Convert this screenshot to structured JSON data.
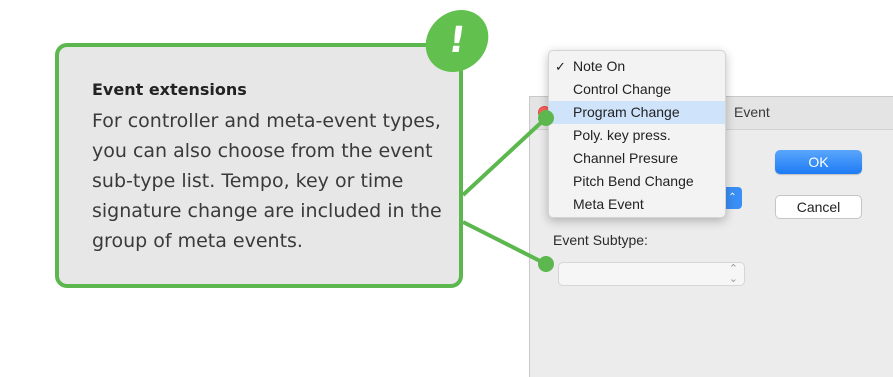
{
  "callout": {
    "title": "Event extensions",
    "body": "For controller and meta-event types, you can also choose from the event sub-type list. Tempo, key or time signature change are included in the group of meta events.",
    "badge": "!"
  },
  "dialog": {
    "title_partial": "Event",
    "ok_label": "OK",
    "cancel_label": "Cancel",
    "subtype_label": "Event Subtype:",
    "subtype_value": ""
  },
  "menu": {
    "items": [
      {
        "label": "Note On",
        "checked": true
      },
      {
        "label": "Control Change",
        "checked": false
      },
      {
        "label": "Program Change",
        "checked": false,
        "highlighted": true
      },
      {
        "label": "Poly. key press.",
        "checked": false
      },
      {
        "label": "Channel Presure",
        "checked": false
      },
      {
        "label": "Pitch Bend Change",
        "checked": false
      },
      {
        "label": "Meta Event",
        "checked": false
      }
    ],
    "check_glyph": "✓"
  },
  "icons": {
    "popup_arrows": "updown-chevron-icon",
    "close_dot": "close-icon"
  },
  "colors": {
    "accent_green": "#5cb84e",
    "callout_bg": "#e6e7e6",
    "ok_blue": "#1d7bf5",
    "highlight": "#cfe3fb"
  }
}
